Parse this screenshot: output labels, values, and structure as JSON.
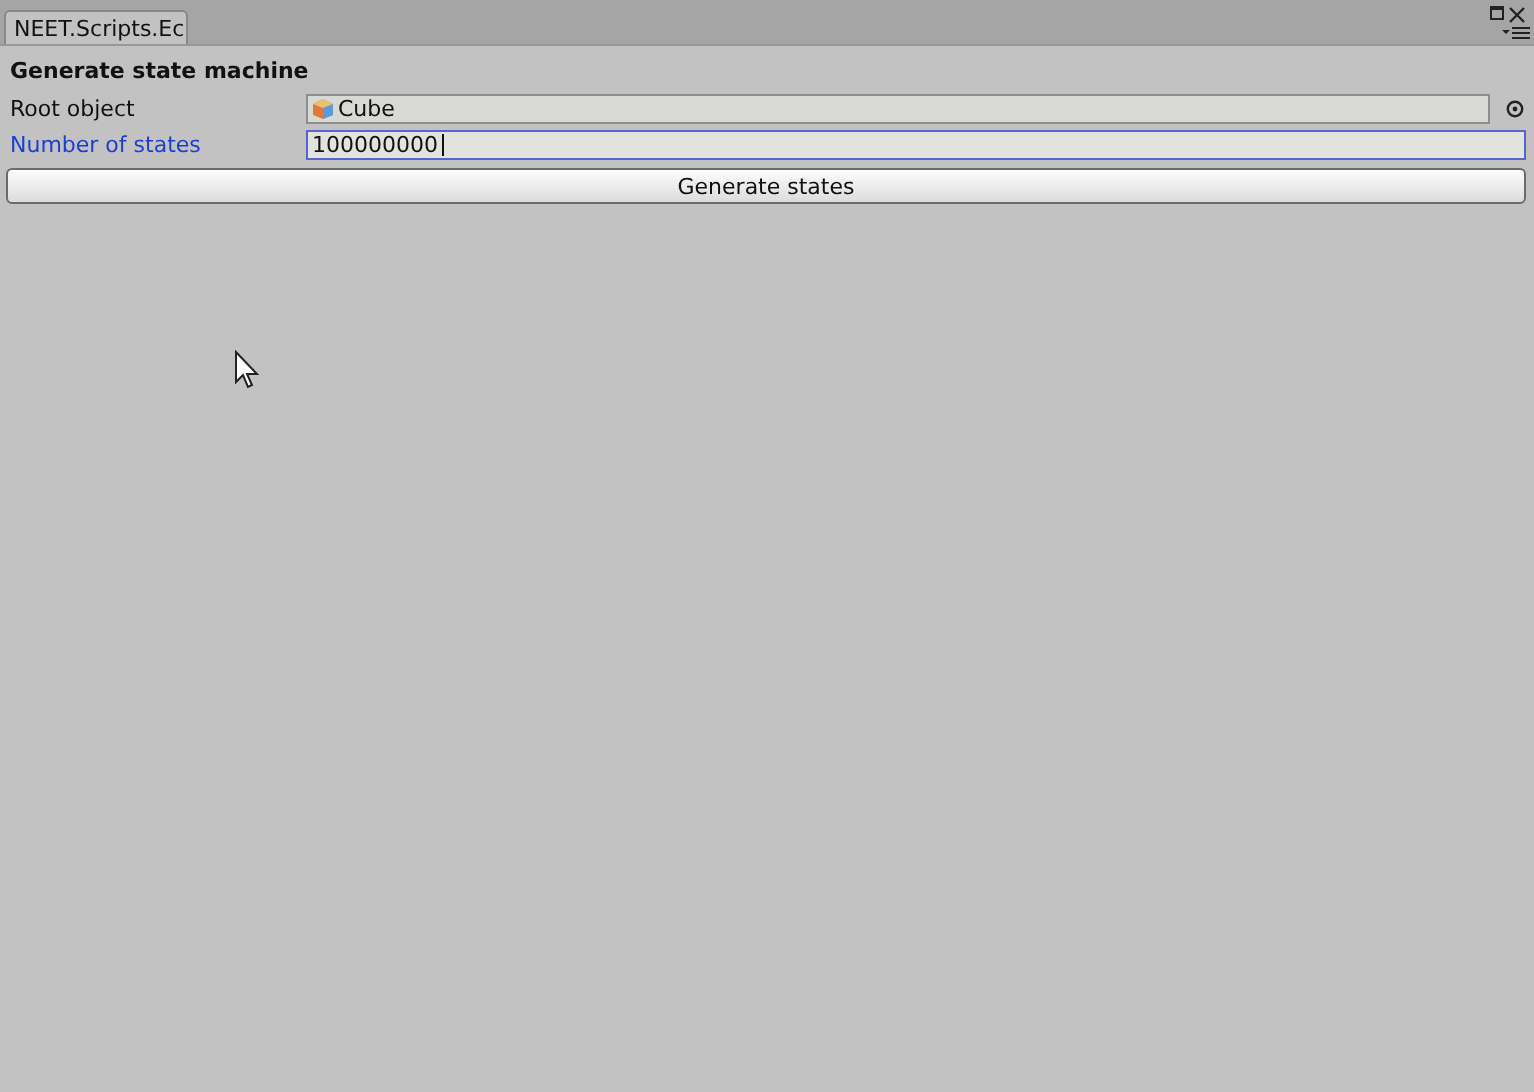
{
  "window": {
    "tab": "NEET.Scripts.Ec"
  },
  "section_title": "Generate state machine",
  "fields": [
    {
      "kind": "object",
      "label": "Root object",
      "value": "Cube",
      "focused": false
    },
    {
      "kind": "number",
      "label": "Number of states",
      "value": "100000000",
      "focused": true
    }
  ],
  "button": "Generate states"
}
